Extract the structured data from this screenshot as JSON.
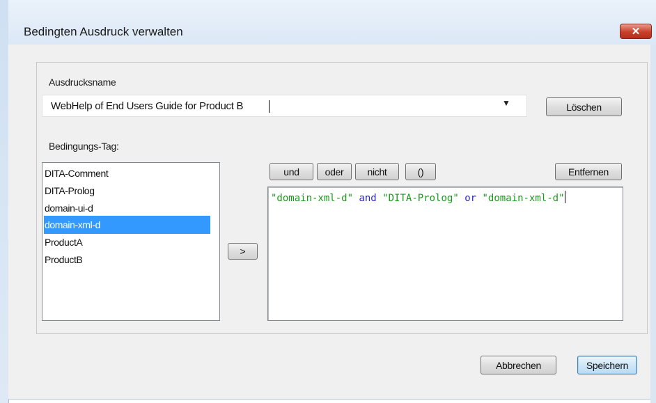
{
  "window": {
    "title": "Bedingten Ausdruck verwalten",
    "close_glyph": "✕"
  },
  "expression_name": {
    "label": "Ausdrucksname",
    "value": "WebHelp of End Users Guide for Product B",
    "dropdown_glyph": "▼",
    "delete_label": "Löschen"
  },
  "condition_tag": {
    "label": "Bedingungs-Tag:",
    "items": [
      "DITA-Comment",
      "DITA-Prolog",
      "domain-ui-d",
      "domain-xml-d",
      "ProductA",
      "ProductB"
    ],
    "selected_index": 3,
    "add_label": ">"
  },
  "operators": {
    "and_label": "und",
    "or_label": "oder",
    "not_label": "nicht",
    "parens_label": "()",
    "remove_label": "Entfernen"
  },
  "expression": {
    "tokens": [
      {
        "text": "\"domain-xml-d\"",
        "kind": "string"
      },
      {
        "text": " ",
        "kind": "space"
      },
      {
        "text": "and",
        "kind": "operator"
      },
      {
        "text": " ",
        "kind": "space"
      },
      {
        "text": "\"DITA-Prolog\"",
        "kind": "string"
      },
      {
        "text": " ",
        "kind": "space"
      },
      {
        "text": "or",
        "kind": "operator"
      },
      {
        "text": " ",
        "kind": "space"
      },
      {
        "text": "\"domain-xml-d\"",
        "kind": "string"
      }
    ],
    "colors": {
      "string": "#1a9a1a",
      "operator": "#2828d0"
    }
  },
  "footer": {
    "cancel_label": "Abbrechen",
    "save_label": "Speichern"
  }
}
